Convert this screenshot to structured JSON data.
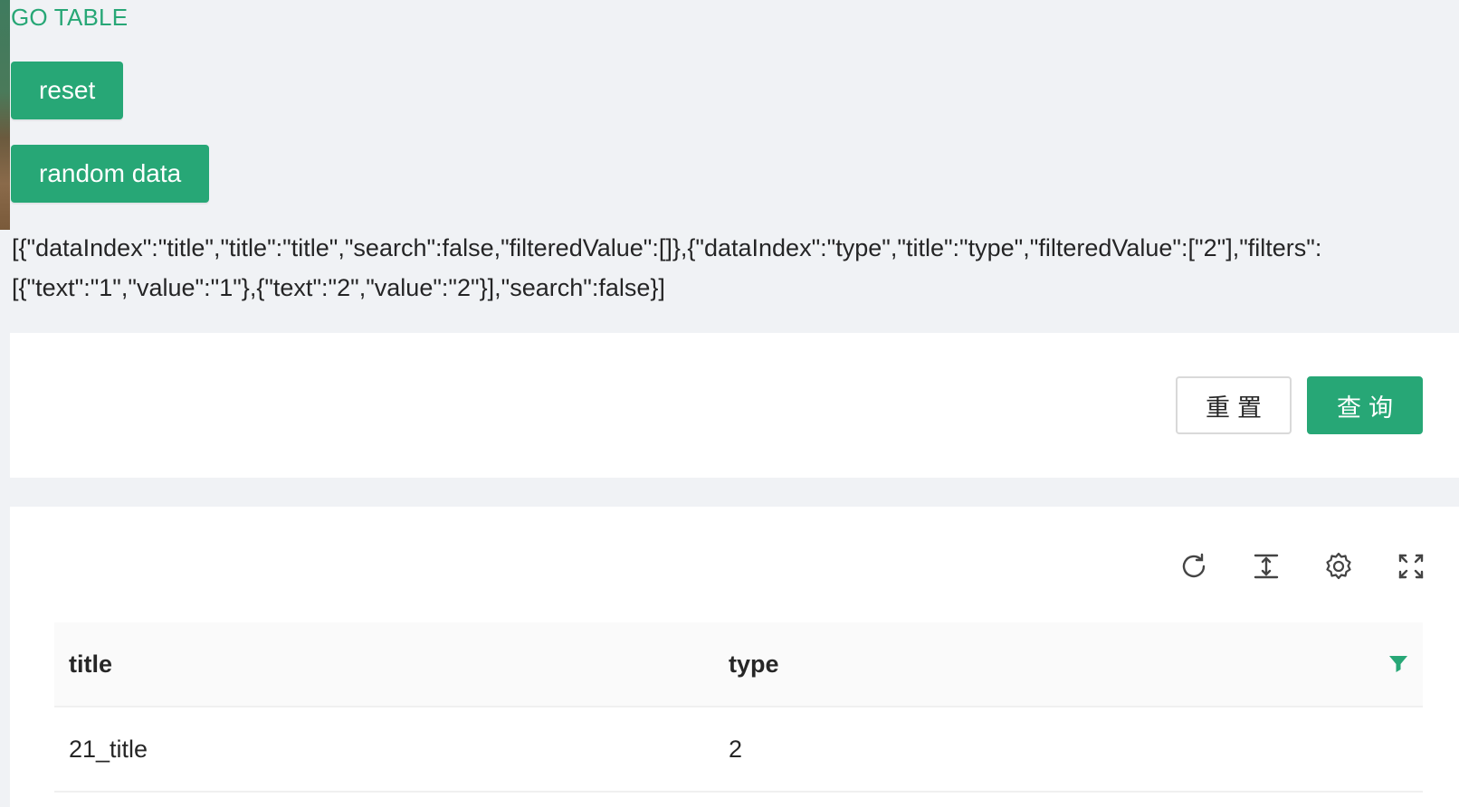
{
  "header": {
    "link_label": "GO TABLE"
  },
  "buttons": {
    "reset_label": "reset",
    "random_label": "random data"
  },
  "columns_json_text": "[{\"dataIndex\":\"title\",\"title\":\"title\",\"search\":false,\"filteredValue\":[]},{\"dataIndex\":\"type\",\"title\":\"type\",\"filteredValue\":[\"2\"],\"filters\":[{\"text\":\"1\",\"value\":\"1\"},{\"text\":\"2\",\"value\":\"2\"}],\"search\":false}]",
  "search_form": {
    "reset_label": "重置",
    "query_label": "查询"
  },
  "toolbar": {
    "icons": [
      "reload-icon",
      "column-height-icon",
      "setting-icon",
      "fullscreen-icon"
    ]
  },
  "table": {
    "columns": [
      "title",
      "type"
    ],
    "rows": [
      {
        "title": "21_title",
        "type": "2"
      }
    ],
    "type_filter_active": true
  },
  "colors": {
    "primary": "#27a776",
    "background": "#f0f2f5"
  }
}
